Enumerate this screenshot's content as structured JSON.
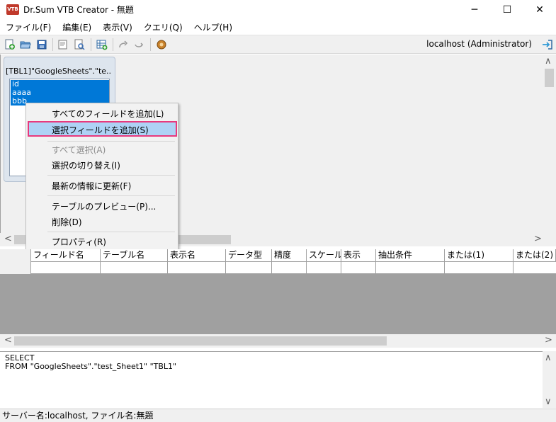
{
  "window": {
    "app_icon_text": "VTB",
    "title": "Dr.Sum VTB Creator - 無題",
    "minimize": "─",
    "maximize": "☐",
    "close": "✕"
  },
  "menu": [
    "ファイル(F)",
    "編集(E)",
    "表示(V)",
    "クエリ(Q)",
    "ヘルプ(H)"
  ],
  "toolbar": {
    "connection": "localhost (Administrator)",
    "icons": [
      "new-icon",
      "open-icon",
      "save-icon",
      "preview-icon",
      "print-preview-icon",
      "add-table-icon",
      "redo-icon",
      "undo-icon",
      "settings-icon",
      "exit-icon"
    ]
  },
  "table_box": {
    "title": "[TBL1]\"GoogleSheets\".\"te...",
    "fields": [
      "id",
      "aaaa",
      "bbb"
    ]
  },
  "context_menu": {
    "items": [
      {
        "label": "すべてのフィールドを追加(L)",
        "disabled": false
      },
      {
        "label": "選択フィールドを追加(S)",
        "disabled": false,
        "highlighted": true
      },
      {
        "label": "すべて選択(A)",
        "disabled": true
      },
      {
        "label": "選択の切り替え(I)",
        "disabled": false
      },
      {
        "label": "最新の情報に更新(F)",
        "disabled": false
      },
      {
        "label": "テーブルのプレビュー(P)...",
        "disabled": false
      },
      {
        "label": "削除(D)",
        "disabled": false
      },
      {
        "label": "プロパティ(R)",
        "disabled": false
      }
    ]
  },
  "grid": {
    "columns": [
      "フィールド名",
      "テーブル名",
      "表示名",
      "データ型",
      "精度",
      "スケール",
      "表示",
      "抽出条件",
      "または(1)",
      "または(2)"
    ]
  },
  "sql": {
    "line1": "SELECT",
    "line2": "FROM \"GoogleSheets\".\"test_Sheet1\" \"TBL1\""
  },
  "status": "サーバー名:localhost, ファイル名:無題",
  "colors": {
    "selection": "#0078d7",
    "menu_highlight": "#aed2f5",
    "highlight_border": "#e8397d"
  }
}
